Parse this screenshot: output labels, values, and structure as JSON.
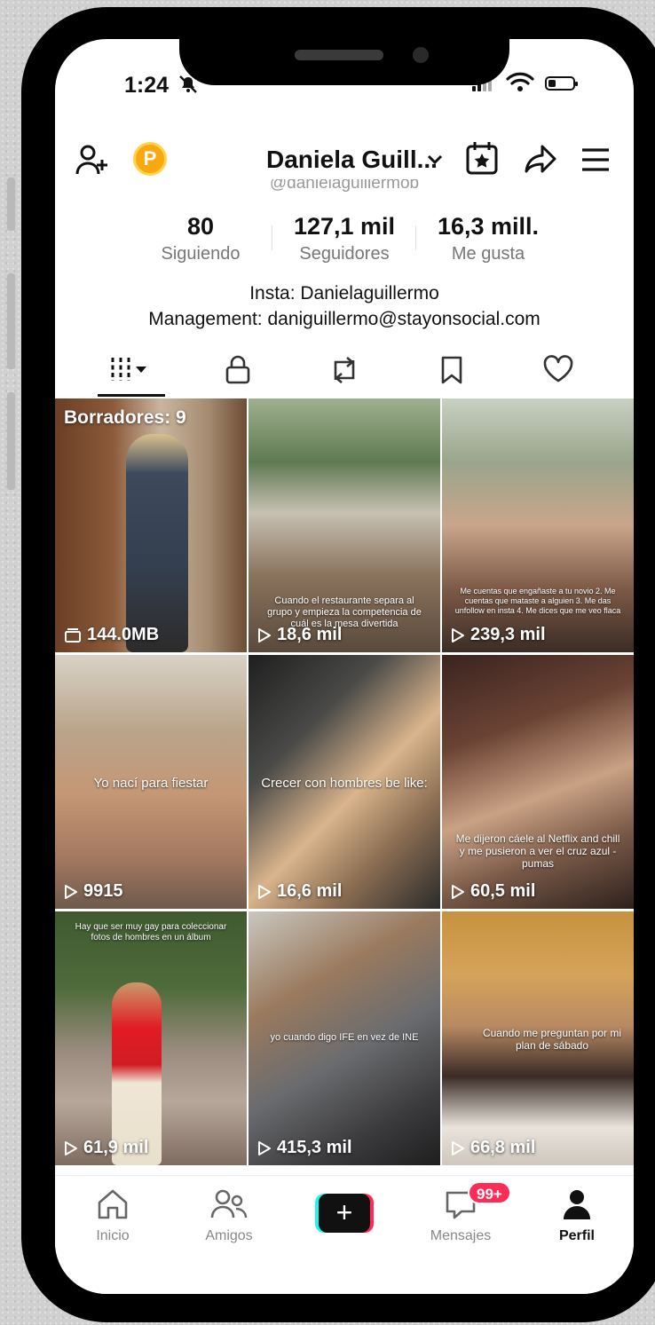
{
  "status_bar": {
    "time": "1:24"
  },
  "header": {
    "username": "Daniela Guill...",
    "handle": "@danielaguillermob",
    "coin_letter": "P"
  },
  "stats": [
    {
      "value": "80",
      "label": "Siguiendo"
    },
    {
      "value": "127,1 mil",
      "label": "Seguidores"
    },
    {
      "value": "16,3 mill.",
      "label": "Me gusta"
    }
  ],
  "bio": {
    "line1": "Insta: Danielaguillermo",
    "line2": "Management: daniguillermo@stayonsocial.com"
  },
  "tabs": [
    "videos-grid-icon",
    "lock-icon",
    "repost-icon",
    "bookmark-icon",
    "heart-icon"
  ],
  "grid": [
    {
      "drafts": "Borradores: 9",
      "views": "144.0MB",
      "caption": ""
    },
    {
      "views": "18,6 mil",
      "caption": "Cuando el restaurante separa al grupo y empieza la competencia de cuál es la mesa divertida"
    },
    {
      "views": "239,3 mil",
      "caption": "Me cuentas que engañaste a tu novio 2. Me cuentas que mataste a alguien 3. Me das unfollow en insta 4. Me dices que me veo flaca"
    },
    {
      "views": "9915",
      "caption": "Yo nací para fiestar"
    },
    {
      "views": "16,6 mil",
      "caption": "Crecer con hombres be like:"
    },
    {
      "views": "60,5 mil",
      "caption": "Me dijeron cáele al Netflix and chill y me pusieron a ver el cruz azul - pumas"
    },
    {
      "views": "61,9 mil",
      "caption": "Hay que ser muy gay para coleccionar fotos de hombres en un álbum"
    },
    {
      "views": "415,3 mil",
      "caption": "yo cuando digo IFE en vez de INE"
    },
    {
      "views": "66,8 mil",
      "caption": "Cuando me preguntan por mi plan de sábado"
    }
  ],
  "tabbar": {
    "home": "Inicio",
    "friends": "Amigos",
    "create": "+",
    "messages": "Mensajes",
    "messages_badge": "99+",
    "profile": "Perfil"
  },
  "colors": {
    "accent": "#fe2c55",
    "cyan": "#25f4ee",
    "coin": "#f8a90f"
  }
}
